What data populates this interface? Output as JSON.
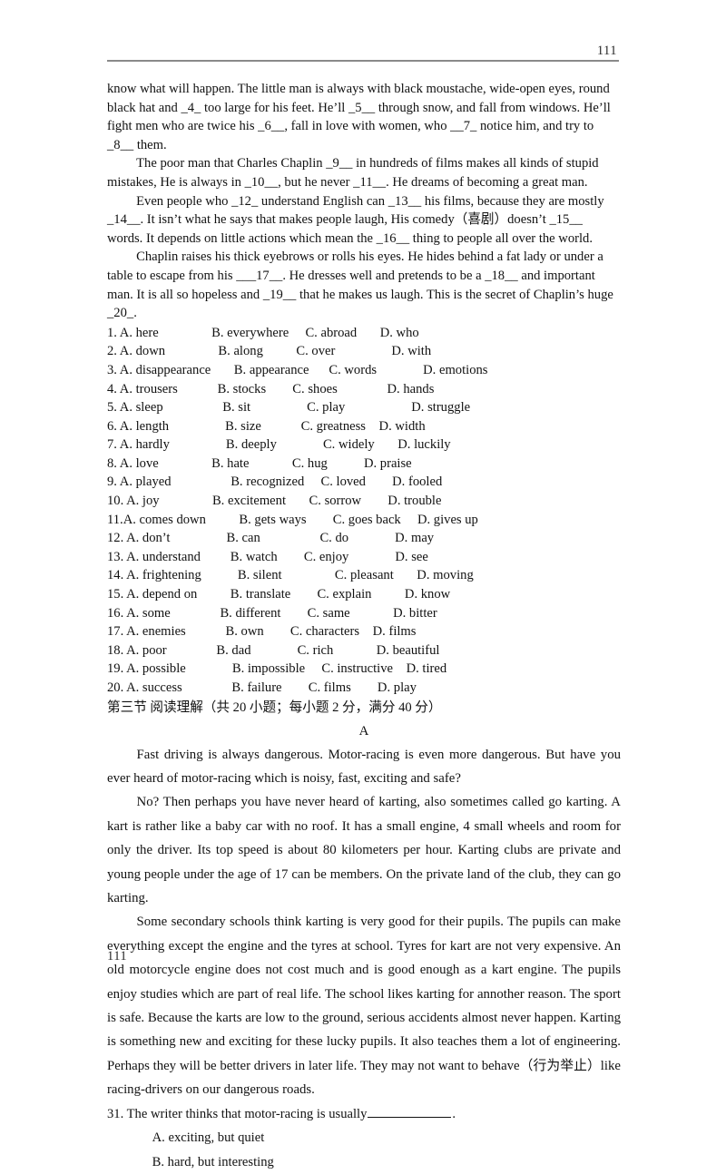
{
  "header": {
    "page_number": "111"
  },
  "footer": {
    "page_number": "111"
  },
  "cloze": {
    "paragraphs": [
      "know what will happen. The little man is always with black moustache, wide-open eyes, round black hat and _4_ too large for his feet. He’ll _5__ through snow, and fall from windows. He’ll fight men who are twice his _6__, fall in love with women, who __7_ notice him, and try to _8__ them.",
      "The poor man that Charles Chaplin _9__ in hundreds of films makes all kinds of stupid mistakes, He is always in _10__, but he never _11__. He dreams of becoming a great man.",
      "Even people who _12_ understand English can _13__ his films, because they are mostly _14__. It isn’t what he says that makes people laugh, His comedy（喜剧）doesn’t _15__ words. It depends on little actions which mean the _16__ thing to people all over the world.",
      "Chaplin raises his thick eyebrows or rolls his eyes. He hides behind a fat lady or under a table to escape from his ___17__. He dresses well and pretends to be a _18__ and important man. It is all so hopeless and _19__ that he makes us laugh. This is the secret of Chaplin’s huge _20_."
    ],
    "option_rows": [
      "1. A. here                B. everywhere     C. abroad       D. who",
      "2. A. down                B. along          C. over                 D. with",
      "3. A. disappearance       B. appearance      C. words              D. emotions",
      "4. A. trousers            B. stocks        C. shoes               D. hands",
      "5. A. sleep                  B. sit                 C. play                    D. struggle",
      "6. A. length                 B. size            C. greatness    D. width",
      "7. A. hardly                 B. deeply              C. widely       D. luckily",
      "8. A. love                B. hate             C. hug           D. praise",
      "9. A. played                  B. recognized     C. loved        D. fooled",
      "10. A. joy                B. excitement       C. sorrow        D. trouble",
      "11.A. comes down          B. gets ways        C. goes back     D. gives up",
      "12. A. don’t                 B. can                  C. do              D. may",
      "13. A. understand         B. watch        C. enjoy              D. see",
      "14. A. frightening           B. silent                C. pleasant       D. moving",
      "15. A. depend on          B. translate        C. explain          D. know",
      "16. A. some               B. different        C. same             D. bitter",
      "17. A. enemies            B. own        C. characters    D. films",
      "18. A. poor               B. dad              C. rich             D. beautiful",
      "19. A. possible              B. impossible     C. instructive    D. tired",
      "20. A. success               B. failure        C. films        D. play"
    ]
  },
  "section_heading": "第三节 阅读理解（共 20 小题；每小题 2 分，满分 40 分）",
  "reading": {
    "passage_letter": "A",
    "paragraphs": [
      "Fast driving is always dangerous. Motor-racing is even more dangerous. But have you ever heard of motor-racing which is noisy, fast, exciting and safe?",
      "No? Then perhaps you have never heard of karting, also sometimes called go karting. A kart is rather like a baby car with no roof. It has a small engine, 4 small wheels and room for only the driver. Its top speed is about 80 kilometers per hour. Karting clubs are private and young people under the age of 17 can be members. On the private land of the club, they can go karting.",
      "Some secondary schools think karting is very good for their pupils. The pupils can make everything except the engine and the tyres at school. Tyres for kart are not very expensive. An old motorcycle engine does not cost much and is good enough as a kart engine. The pupils enjoy studies which are part of real life. The school likes karting for annother reason. The sport is safe. Because the karts are low to the ground, serious accidents almost never happen. Karting is something new and exciting for these lucky pupils. It also teaches them a lot of engineering. Perhaps they will be better drivers in later life. They may not want to behave（行为举止）like racing-drivers on our dangerous roads."
    ],
    "question": {
      "number_and_stem": "31. The writer thinks that motor-racing is usually",
      "trailing_period": ".",
      "choices": [
        "A. exciting, but quiet",
        "B. hard, but interesting"
      ]
    }
  }
}
